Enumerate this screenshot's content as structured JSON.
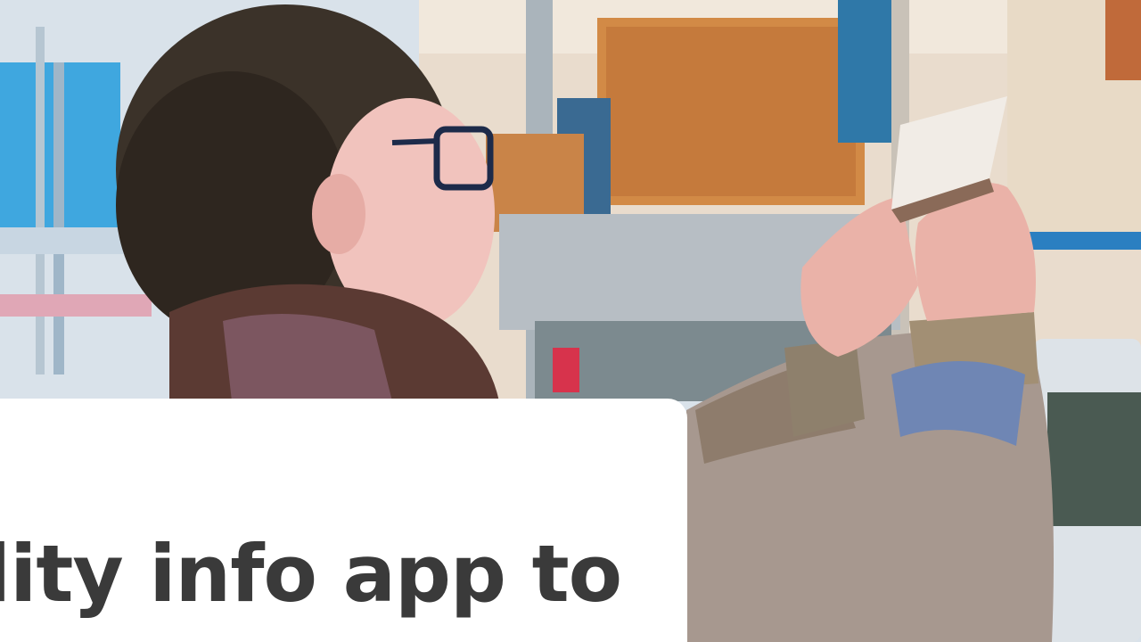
{
  "article": {
    "headline_fragment": "lity info app to"
  },
  "hero_image": {
    "subject": "photo-person-taking-photo-with-phone"
  },
  "colors": {
    "card_background": "#ffffff",
    "headline_text": "#3a3a3a"
  }
}
